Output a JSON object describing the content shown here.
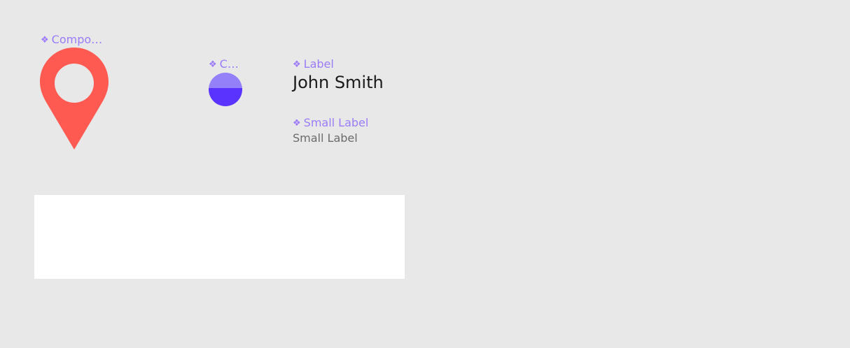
{
  "components": {
    "pin": {
      "label": "Compo…",
      "icon": "map-pin-icon",
      "color": "#ff5a52"
    },
    "dot": {
      "label": "C…",
      "icon": "half-circle-icon",
      "color_top": "#9480f8",
      "color_bottom": "#5a33ff"
    },
    "label": {
      "label": "Label",
      "value": "John Smith"
    },
    "small_label": {
      "label": "Small Label",
      "value": "Small Label"
    }
  },
  "component_glyph": "❖",
  "colors": {
    "canvas": "#e8e8e8",
    "component_label": "#9b7cf6",
    "panel": "#ffffff"
  }
}
